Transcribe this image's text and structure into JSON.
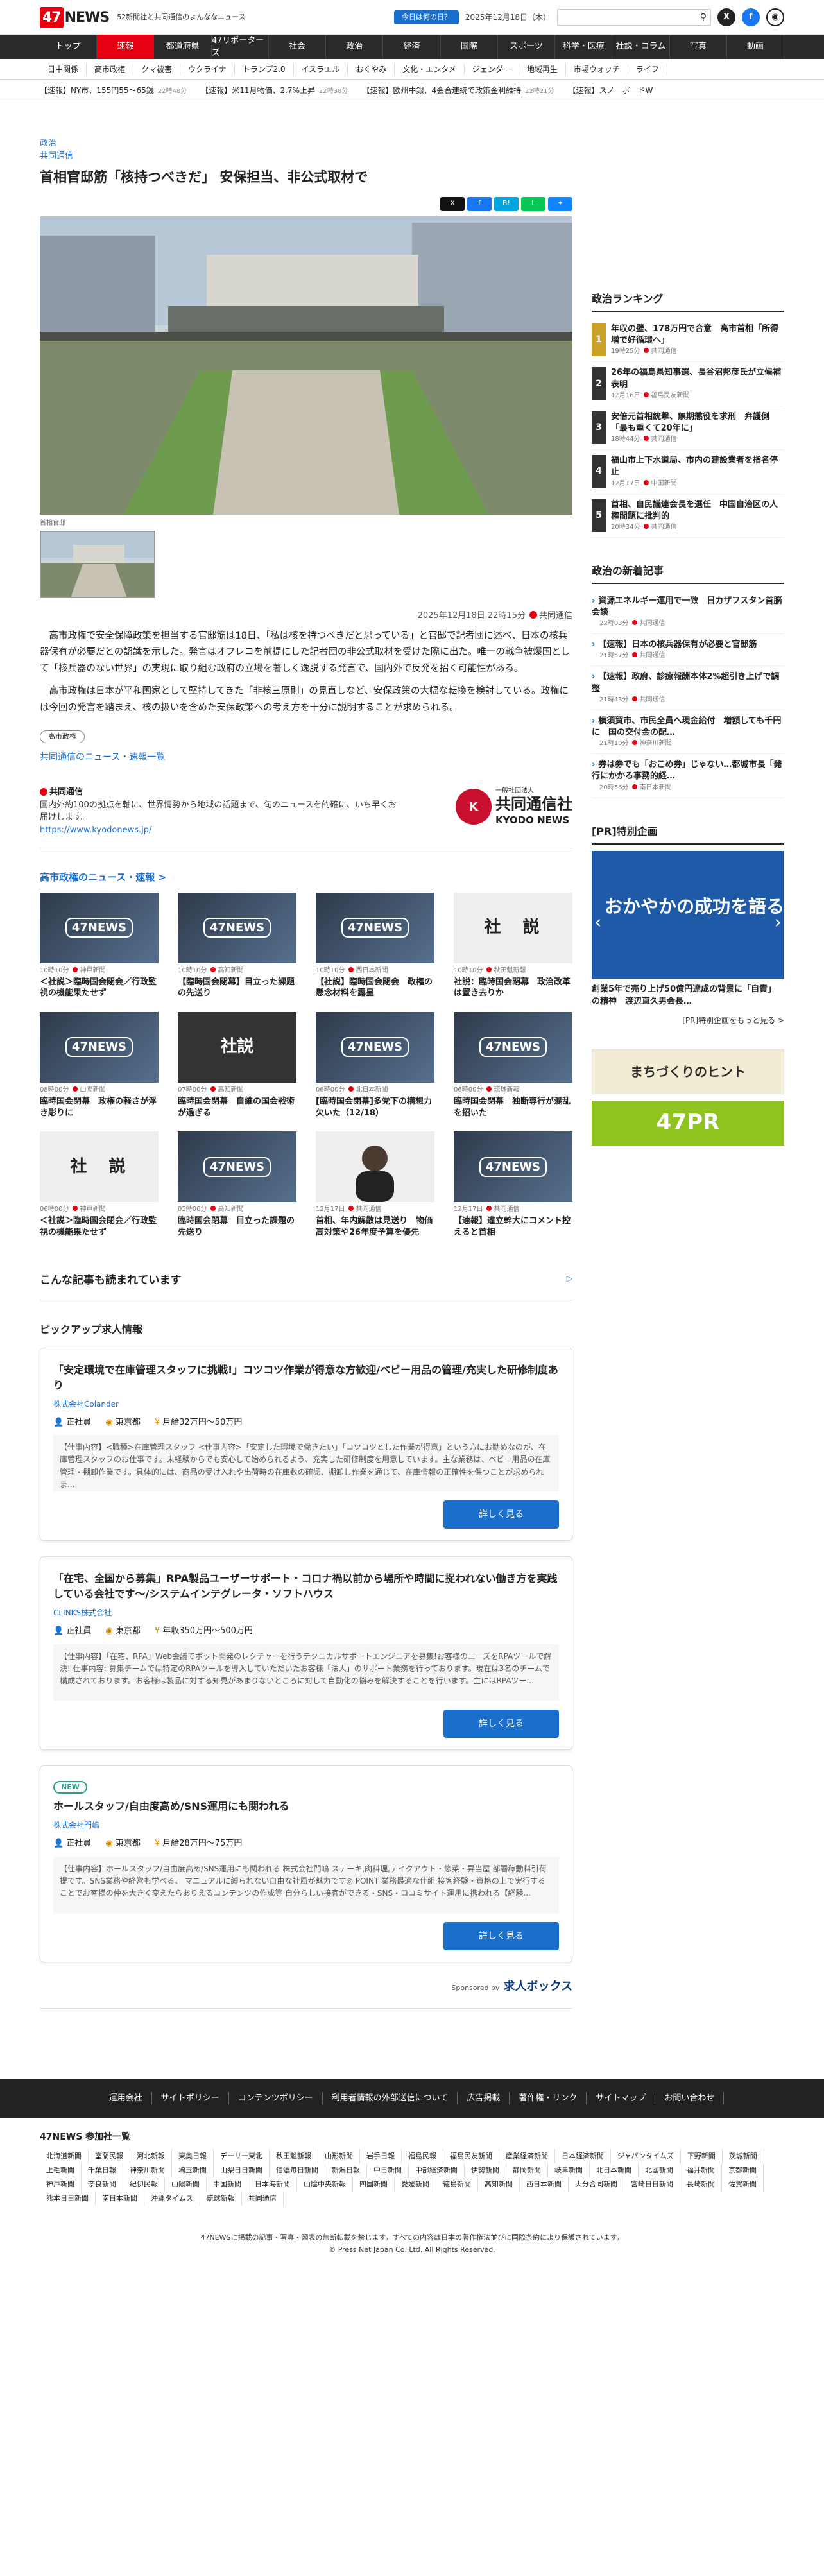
{
  "header": {
    "logo_num": "47",
    "logo_text": "NEWS",
    "tagline": "52新聞社と共同通信のよんななニュース",
    "today_btn": "今日は何の日？",
    "date": "2025年12月18日（木）"
  },
  "nav": [
    "トップ",
    "速報",
    "都道府県",
    "47リポーターズ",
    "社会",
    "政治",
    "経済",
    "国際",
    "スポーツ",
    "科学・医療",
    "社説・コラム",
    "写真",
    "動画"
  ],
  "subnav": [
    "日中関係",
    "高市政権",
    "クマ被害",
    "ウクライナ",
    "トランプ2.0",
    "イスラエル",
    "おくやみ",
    "文化・エンタメ",
    "ジェンダー",
    "地域再生",
    "市場ウォッチ",
    "ライフ"
  ],
  "ticker": [
    {
      "text": "【速報】NY市、155円55〜65銭",
      "time": "22時48分"
    },
    {
      "text": "【速報】米11月物価、2.7%上昇",
      "time": "22時38分"
    },
    {
      "text": "【速報】欧州中銀、4会合連続で政策金利維持",
      "time": "22時21分"
    },
    {
      "text": "【速報】スノーボードW"
    }
  ],
  "article": {
    "cat1": "政治",
    "cat2": "共同通信",
    "title": "首相官邸筋「核持つべきだ」 安保担当、非公式取材で",
    "caption": "首相官邸",
    "datetime": "2025年12月18日 22時15分",
    "source": "共同通信",
    "paragraphs": [
      "高市政権で安全保障政策を担当する官邸筋は18日、「私は核を持つべきだと思っている」と官邸で記者団に述べ、日本の核兵器保有が必要だとの認識を示した。発言はオフレコを前提にした記者団の非公式取材を受けた際に出た。唯一の戦争被爆国として「核兵器のない世界」の実現に取り組む政府の立場を著しく逸脱する発言で、国内外で反発を招く可能性がある。",
      "高市政権は日本が平和国家として堅持してきた「非核三原則」の見直しなど、安保政策の大幅な転換を検討している。政権には今回の発言を踏まえ、核の扱いを含めた安保政策への考え方を十分に説明することが求められる。"
    ],
    "tag": "高市政権",
    "more": "共同通信のニュース・速報一覧"
  },
  "provider": {
    "name": "共同通信",
    "desc": "国内外約100の拠点を軸に、世界情勢から地域の話題まで、旬のニュースを的確に、いち早くお届けします。",
    "url": "https://www.kyodonews.jp/",
    "logo_small": "一般社団法人",
    "logo_name": "共同通信社",
    "logo_en": "KYODO NEWS"
  },
  "related": {
    "heading": "高市政権のニュース・速報 >",
    "items": [
      {
        "img": "47NEWS",
        "time": "10時10分",
        "src": "神戸新聞",
        "title": "＜社説＞臨時国会閉会／行政監視の機能果たせず"
      },
      {
        "img": "47NEWS",
        "time": "10時10分",
        "src": "高知新聞",
        "title": "【臨時国会閉幕】目立った課題の先送り"
      },
      {
        "img": "47NEWS",
        "time": "10時10分",
        "src": "西日本新聞",
        "title": "【社説】臨時国会閉会　政権の懸念材料を露呈"
      },
      {
        "img": "社　説",
        "time": "10時10分",
        "src": "秋田魁新報",
        "title": "社説：臨時国会閉幕　政治改革は置き去りか"
      },
      {
        "img": "47NEWS",
        "time": "08時00分",
        "src": "山陽新聞",
        "title": "臨時国会閉幕　政権の軽さが浮き彫りに"
      },
      {
        "img": "社説",
        "time": "07時00分",
        "src": "高知新聞",
        "title": "臨時国会閉幕　自維の国会戦術が過ぎる"
      },
      {
        "img": "47NEWS",
        "time": "06時00分",
        "src": "北日本新聞",
        "title": "[臨時国会閉幕]多党下の構想力欠いた（12/18）"
      },
      {
        "img": "47NEWS",
        "time": "06時00分",
        "src": "琉球新報",
        "title": "臨時国会閉幕　独断専行が混乱を招いた"
      },
      {
        "img": "社　説",
        "time": "06時00分",
        "src": "神戸新聞",
        "title": "＜社説＞臨時国会閉会／行政監視の機能果たせず"
      },
      {
        "img": "47NEWS",
        "time": "05時00分",
        "src": "高知新聞",
        "title": "臨時国会閉幕　目立った課題の先送り"
      },
      {
        "img": "",
        "time": "12月17日",
        "src": "共同通信",
        "title": "首相、年内解散は見送り　物価高対策や26年度予算を優先"
      },
      {
        "img": "47NEWS",
        "time": "12月17日",
        "src": "共同通信",
        "title": "【速報】違立幹大にコメント控えると首相"
      }
    ]
  },
  "recommend": {
    "heading": "こんな記事も読まれています",
    "ad": "▷"
  },
  "jobs": {
    "heading": "ピックアップ求人情報",
    "items": [
      {
        "new": "",
        "title": "「安定環境で在庫管理スタッフに挑戦!」コツコツ作業が得意な方歓迎/ベビー用品の管理/充実した研修制度あり",
        "company": "株式会社Colander",
        "type": "正社員",
        "place": "東京都",
        "pay": "月給32万円〜50万円",
        "desc": "【仕事内容】<職種>在庫管理スタッフ <仕事内容>「安定した環境で働きたい」「コツコツとした作業が得意」という方にお勧めなのが、在庫管理スタッフのお仕事です。未経験からでも安心して始められるよう、充実した研修制度を用意しています。主な業務は、ベビー用品の在庫管理・棚卸作業です。具体的には、商品の受け入れや出荷時の在庫数の確認、棚卸し作業を通じて、在庫情報の正確性を保つことが求められま...",
        "btn": "詳しく見る"
      },
      {
        "new": "",
        "title": "「在宅、全国から募集」RPA製品ユーザーサポート・コロナ禍以前から場所や時間に捉われない働き方を実践している会社です〜/システムインテグレータ・ソフトハウス",
        "company": "CLINKS株式会社",
        "type": "正社員",
        "place": "東京都",
        "pay": "年収350万円〜500万円",
        "desc": "【仕事内容】「在宅、RPA」Web会議でポット開発のレクチャーを行うテクニカルサポートエンジニアを募集!お客様のニーズをRPAツールで解決! 仕事内容: 募集チームでは特定のRPAツールを導入していただいたお客様「法人」のサポート業務を行っております。現在は3名のチームで構成されております。お客様は製品に対する知見があまりないところに対して自動化の悩みを解決することを行います。主にはRPAツー...",
        "btn": "詳しく見る"
      },
      {
        "new": "NEW",
        "title": "ホールスタッフ/自由度高め/SNS運用にも関われる",
        "company": "株式会社門嶋",
        "type": "正社員",
        "place": "東京都",
        "pay": "月給28万円〜75万円",
        "desc": "【仕事内容】ホールスタッフ/自由度高め/SNS運用にも関われる 株式会社門嶋 ステーキ,肉料理,テイクアウト・惣菜・昇当屋 部署稼動料引荷提です。SNS業務や経営も学べる。 マニュアルに縛られない自由な社風が魅力です◎ POINT 業務最適な仕組 接客経験・資格の上で実行することでお客様の仲を大きく変えたらありえるコンテンツの作成等 自分らしい接客ができる・SNS・ロコミサイト運用に携われる【経験...",
        "btn": "詳しく見る"
      }
    ],
    "sponsor_label": "Sponsored by",
    "sponsor": "求人ボックス"
  },
  "sidebar": {
    "ranking_title": "政治ランキング",
    "ranking": [
      {
        "n": "1",
        "title": "年収の壁、178万円で合意　高市首相「所得増で好循環へ」",
        "time": "19時25分",
        "src": "共同通信"
      },
      {
        "n": "2",
        "title": "26年の福島県知事選、長谷沼邦彦氏が立候補表明",
        "time": "12月16日",
        "src": "福島民友新聞"
      },
      {
        "n": "3",
        "title": "安倍元首相銃撃、無期懲役を求刑　弁護側「最も重くて20年に」",
        "time": "18時44分",
        "src": "共同通信"
      },
      {
        "n": "4",
        "title": "福山市上下水道局、市内の建設業者を指名停止",
        "time": "12月17日",
        "src": "中国新聞"
      },
      {
        "n": "5",
        "title": "首相、自民議連会長を選任　中国自治区の人権問題に批判的",
        "time": "20時34分",
        "src": "共同通信"
      }
    ],
    "newest_title": "政治の新着記事",
    "newest": [
      {
        "title": "資源エネルギー運用で一致　日カザフスタン首脳会談",
        "time": "22時03分",
        "src": "共同通信"
      },
      {
        "title": "【速報】日本の核兵器保有が必要と官邸筋",
        "time": "21時57分",
        "src": "共同通信"
      },
      {
        "title": "【速報】政府、診療報酬本体2%超引き上げで調整",
        "time": "21時43分",
        "src": "共同通信"
      },
      {
        "title": "横須賀市、市民全員へ現金給付　増額しても千円に　国の交付金の配…",
        "time": "21時10分",
        "src": "神奈川新聞"
      },
      {
        "title": "券は券でも「おこめ券」じゃない…都城市長「発行にかかる事務的経…",
        "time": "20時56分",
        "src": "南日本新聞"
      }
    ],
    "pr_title": "[PR]特別企画",
    "pr_banner": "おかやかの成功を語る",
    "pr_desc": "創業5年で売り上げ50億円達成の背景に「自責」の精神　渡辺直久男会長…",
    "pr_link": "[PR]特別企画をもっと見る >",
    "banner1": "まちづくりのヒント",
    "banner2": "47PR"
  },
  "footer": {
    "links": [
      "運用会社",
      "サイトポリシー",
      "コンテンツポリシー",
      "利用者情報の外部送信について",
      "広告掲載",
      "著作権・リンク",
      "サイトマップ",
      "お問い合わせ"
    ],
    "members_title": "47NEWS 参加社一覧",
    "members": [
      "北海道新聞",
      "室蘭民報",
      "河北新報",
      "東奥日報",
      "デーリー東北",
      "秋田魁新報",
      "山形新聞",
      "岩手日報",
      "福島民報",
      "福島民友新聞",
      "産業経済新聞",
      "日本経済新聞",
      "ジャパンタイムズ",
      "下野新聞",
      "茨城新聞",
      "上毛新聞",
      "千葉日報",
      "神奈川新聞",
      "埼玉新聞",
      "山梨日日新聞",
      "信濃毎日新聞",
      "新潟日報",
      "中日新聞",
      "中部経済新聞",
      "伊勢新聞",
      "静岡新聞",
      "岐阜新聞",
      "北日本新聞",
      "北國新聞",
      "福井新聞",
      "京都新聞",
      "神戸新聞",
      "奈良新聞",
      "紀伊民報",
      "山陽新聞",
      "中国新聞",
      "日本海新聞",
      "山陰中央新報",
      "四国新聞",
      "愛媛新聞",
      "徳島新聞",
      "高知新聞",
      "西日本新聞",
      "大分合同新聞",
      "宮崎日日新聞",
      "長崎新聞",
      "佐賀新聞",
      "熊本日日新聞",
      "南日本新聞",
      "沖縄タイムス",
      "琉球新報",
      "共同通信"
    ],
    "copy1": "47NEWSに掲載の記事・写真・図表の無断転載を禁じます。すべての内容は日本の著作権法並びに国際条約により保護されています。",
    "copy2": "© Press Net Japan Co.,Ltd. All Rights Reserved."
  }
}
